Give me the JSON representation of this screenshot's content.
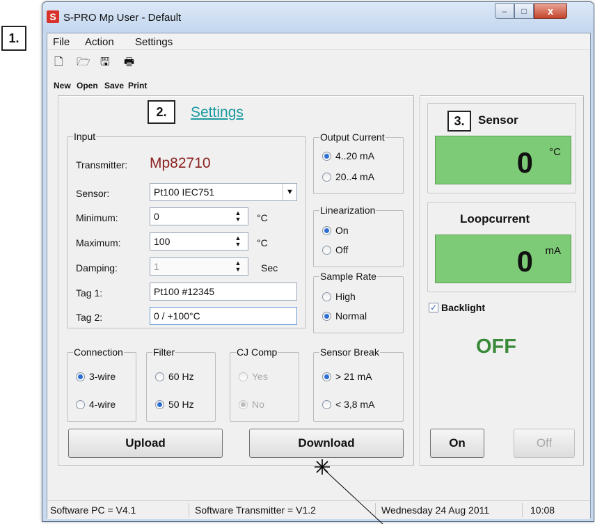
{
  "callouts": [
    "1.",
    "2.",
    "3."
  ],
  "window": {
    "title": "S-PRO Mp User - Default",
    "app_icon_glyph": "S",
    "controls": {
      "minimize": "–",
      "maximize": "□",
      "close": "x"
    }
  },
  "menu": [
    "File",
    "Action",
    "Settings"
  ],
  "toolbar": {
    "icons": [
      "new-file-icon",
      "open-folder-icon",
      "save-disk-icon",
      "print-icon"
    ],
    "glyphs": [
      "🗋",
      "🗁",
      "🖫",
      "🖶"
    ],
    "labels": [
      "New",
      "Open",
      "Save",
      "Print"
    ]
  },
  "settings": {
    "link": "Settings",
    "input": {
      "title": "Input",
      "transmitter_label": "Transmitter:",
      "transmitter_value": "Mp82710",
      "sensor_label": "Sensor:",
      "sensor_value": "Pt100 IEC751",
      "minimum_label": "Minimum:",
      "minimum_value": "0",
      "minimum_unit": "°C",
      "maximum_label": "Maximum:",
      "maximum_value": "100",
      "maximum_unit": "°C",
      "damping_label": "Damping:",
      "damping_value": "1",
      "damping_unit": "Sec",
      "tag1_label": "Tag 1:",
      "tag1_value": "Pt100 #12345",
      "tag2_label": "Tag 2:",
      "tag2_value": "0 / +100°C"
    },
    "output_current": {
      "title": "Output Current",
      "options": [
        "4..20 mA",
        "20..4 mA"
      ],
      "selected": 0
    },
    "linearization": {
      "title": "Linearization",
      "options": [
        "On",
        "Off"
      ],
      "selected": 0
    },
    "sample_rate": {
      "title": "Sample Rate",
      "options": [
        "High",
        "Normal"
      ],
      "selected": 1
    },
    "connection": {
      "title": "Connection",
      "options": [
        "3-wire",
        "4-wire"
      ],
      "selected": 0
    },
    "filter": {
      "title": "Filter",
      "options": [
        "60 Hz",
        "50 Hz"
      ],
      "selected": 1
    },
    "cj_comp": {
      "title": "CJ Comp",
      "options": [
        "Yes",
        "No"
      ],
      "selected": 1,
      "disabled": true
    },
    "sensor_break": {
      "title": "Sensor Break",
      "options": [
        "> 21  mA",
        "< 3,8 mA"
      ],
      "selected": 0
    },
    "upload_label": "Upload",
    "download_label": "Download"
  },
  "monitor": {
    "sensor_title": "Sensor",
    "sensor_value": "0",
    "sensor_unit": "°C",
    "loop_title": "Loopcurrent",
    "loop_value": "0",
    "loop_unit": "mA",
    "backlight_label": "Backlight",
    "backlight_checked": true,
    "status_text": "OFF",
    "status_color": "#3a8a3a",
    "on_label": "On",
    "off_label": "Off",
    "display_color": "#7ecb77"
  },
  "statusbar": {
    "software_pc": "Software PC  = V4.1",
    "software_transmitter": "Software Transmitter = V1.2",
    "date": "Wednesday 24 Aug 2011",
    "time": "10:08"
  }
}
